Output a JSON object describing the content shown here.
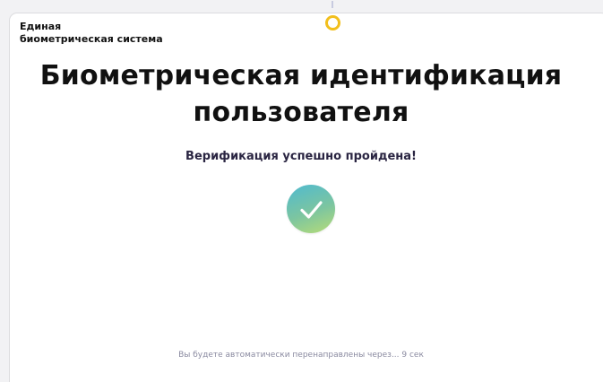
{
  "brand": {
    "line1": "Единая",
    "line2": "биометрическая система"
  },
  "main": {
    "title_line1": "Биометрическая идентификация",
    "title_line2": "пользователя",
    "status_message": "Верификация успешно пройдена!",
    "success_icon": "checkmark-icon",
    "redirect_message": "Вы будете автоматически перенаправлены через... 9 сек"
  },
  "indicators": {
    "camera_icon": "camera-indicator-icon"
  },
  "colors": {
    "indicator": "#f2bf1c",
    "success_gradient_start": "#4fbad0",
    "success_gradient_end": "#b7dc77",
    "title_text": "#111111",
    "status_text": "#2a2542",
    "muted_text": "#8a8aa0"
  }
}
